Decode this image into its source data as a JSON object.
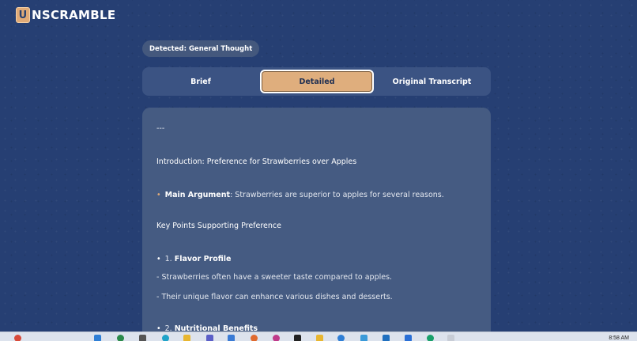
{
  "app": {
    "logo_letter": "U",
    "logo_rest": "NSCRAMBLE"
  },
  "detected_badge": "Detected: General Thought",
  "tabs": [
    {
      "label": "Brief",
      "selected": false
    },
    {
      "label": "Detailed",
      "selected": true
    },
    {
      "label": "Original Transcript",
      "selected": false
    }
  ],
  "content": {
    "divider": "---",
    "intro_heading": "Introduction: Preference for Strawberries over Apples",
    "main_argument_label": "Main Argument",
    "main_argument_text": ": Strawberries are superior to apples for several reasons.",
    "key_points_heading": "Key Points Supporting Preference",
    "point1_number": "1. ",
    "point1_label": "Flavor Profile",
    "point1_line1": "- Strawberries often have a sweeter taste compared to apples.",
    "point1_line2": "- Their unique flavor can enhance various dishes and desserts.",
    "point2_number": "2. ",
    "point2_label": "Nutritional Benefits"
  },
  "taskbar": {
    "clock": "8:58 AM"
  },
  "colors": {
    "background": "#263f73",
    "accent": "#dfae7d",
    "panel": "#455b82"
  }
}
